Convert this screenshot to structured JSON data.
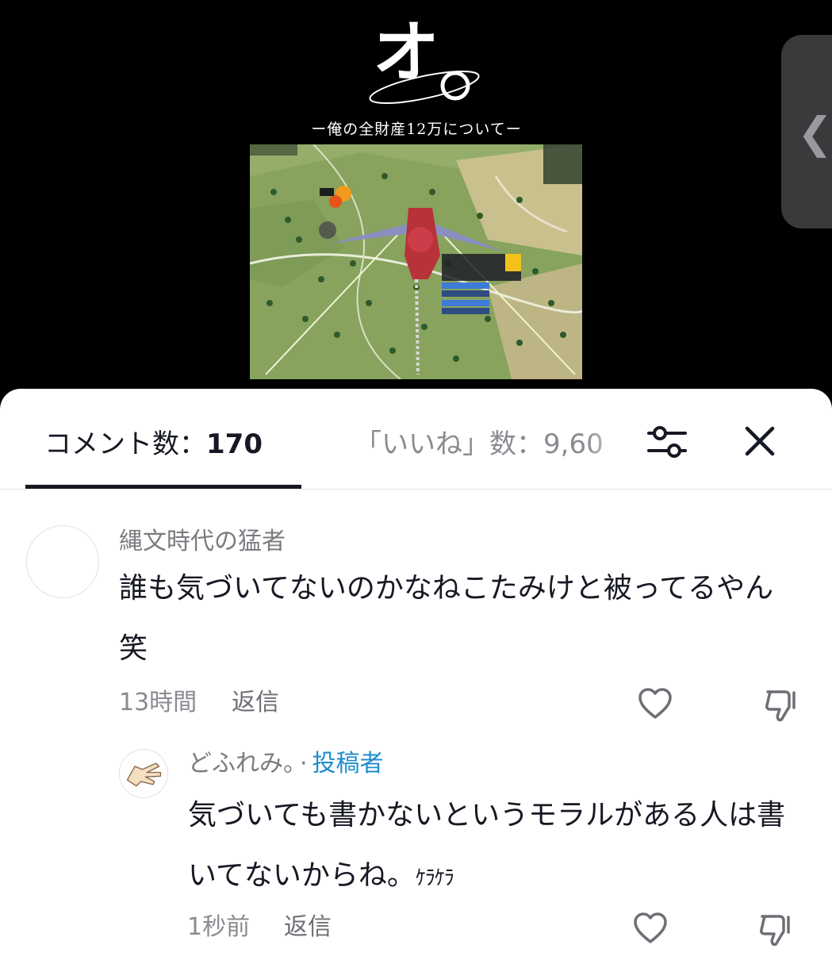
{
  "video": {
    "logo_char": "オ",
    "subtitle": "ー俺の全財産12万についてー"
  },
  "side_tab": {
    "icon": "chevron-left-icon",
    "glyph": "❮"
  },
  "comments_panel": {
    "tabs": {
      "comments_label": "コメント数：",
      "comments_count": "170",
      "likes_label": "「いいね」数：9,60"
    },
    "icons": {
      "filter": "filter-sliders-icon",
      "close": "close-icon"
    },
    "colors": {
      "author_badge": "#1f8ccc",
      "text": "#161823",
      "muted": "#8a8b91"
    }
  },
  "comments": [
    {
      "username": "縄文時代の猛者",
      "text": "誰も気づいてないのかなねこたみけと被ってるやん笑",
      "time": "13時間",
      "reply_label": "返信"
    }
  ],
  "reply": {
    "username": "どふれみ。",
    "separator": "·",
    "author_label": "投稿者",
    "text_main": "気づいても書かないというモラルがある人は書いてないからね。",
    "text_suffix": "ｹﾗｹﾗ",
    "time": "1秒前",
    "reply_label": "返信"
  }
}
